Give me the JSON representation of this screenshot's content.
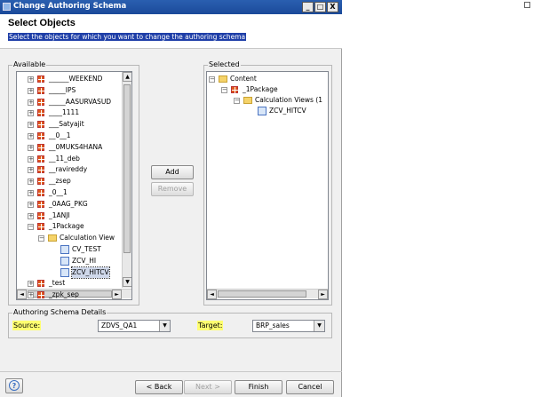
{
  "window": {
    "title": "Change Authoring Schema",
    "min": "_",
    "max": "□",
    "close": "X"
  },
  "header": {
    "title": "Select Objects",
    "description": "Select the objects for which you want to change the authoring schema"
  },
  "available": {
    "label": "Available",
    "items": [
      {
        "label": "______WEEKEND",
        "icon": "package"
      },
      {
        "label": "_____IPS",
        "icon": "package"
      },
      {
        "label": "_____AASURVASUD",
        "icon": "package"
      },
      {
        "label": "____1111",
        "icon": "package"
      },
      {
        "label": "___Satyajit",
        "icon": "package"
      },
      {
        "label": "__0__1",
        "icon": "package"
      },
      {
        "label": "__0MUKS4HANA",
        "icon": "package"
      },
      {
        "label": "__11_deb",
        "icon": "package"
      },
      {
        "label": "__ravireddy",
        "icon": "package"
      },
      {
        "label": "__zsep",
        "icon": "package"
      },
      {
        "label": "_0__1",
        "icon": "package"
      },
      {
        "label": "_0AAG_PKG",
        "icon": "package"
      },
      {
        "label": "_1ANJI",
        "icon": "package"
      },
      {
        "label": "_1Package",
        "icon": "package"
      },
      {
        "label": "Calculation View",
        "icon": "folder"
      },
      {
        "label": "CV_TEST",
        "icon": "calc-view"
      },
      {
        "label": "ZCV_HI",
        "icon": "calc-view"
      },
      {
        "label": "ZCV_HITCV",
        "icon": "calc-view"
      },
      {
        "label": "_test",
        "icon": "package"
      },
      {
        "label": "_zpk_sep",
        "icon": "package"
      }
    ]
  },
  "selected": {
    "label": "Selected",
    "items": [
      {
        "label": "Content",
        "icon": "folder"
      },
      {
        "label": "_1Package",
        "icon": "package"
      },
      {
        "label": "Calculation Views (1",
        "icon": "folder"
      },
      {
        "label": "ZCV_HITCV",
        "icon": "calc-view"
      }
    ]
  },
  "buttons": {
    "add": "Add",
    "remove": "Remove",
    "back": "< Back",
    "next": "Next >",
    "finish": "Finish",
    "cancel": "Cancel",
    "help": "?"
  },
  "schema": {
    "label": "Authoring Schema Details",
    "source_label": "Source:",
    "source_value": "ZDVS_QA1",
    "target_label": "Target:",
    "target_value": "BRP_sales"
  },
  "scroll": {
    "up": "▲",
    "down": "▼",
    "left": "◄",
    "right": "►"
  },
  "tree_glyphs": {
    "expanded": "−",
    "collapsed": "+"
  },
  "colors": {
    "titlebar": "#1b4a9a",
    "selection": "#1f3fa8",
    "highlight": "#ffff70"
  }
}
